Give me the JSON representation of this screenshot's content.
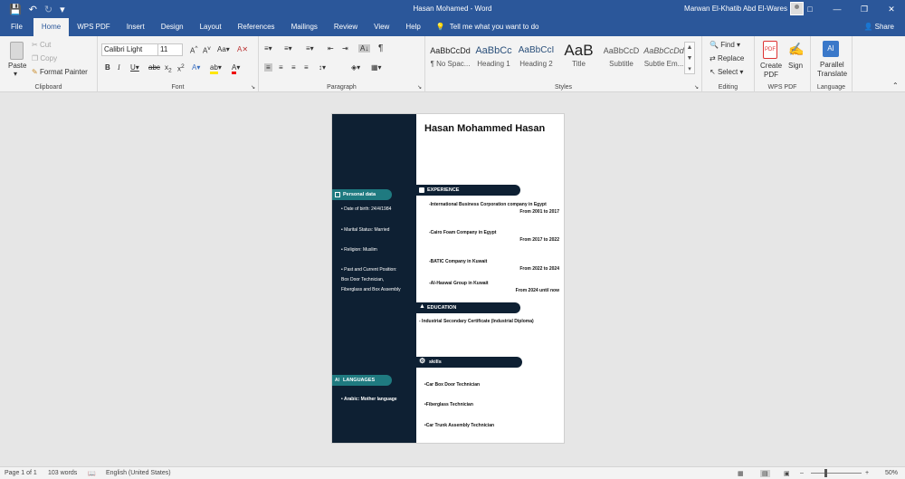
{
  "window": {
    "doc_title": "Hasan Mohamed  -  Word",
    "user_name": "Marwan El-Khatib Abd El-Wares"
  },
  "tabs": [
    "File",
    "Home",
    "WPS PDF",
    "Insert",
    "Design",
    "Layout",
    "References",
    "Mailings",
    "Review",
    "View",
    "Help"
  ],
  "tell_me": "Tell me what you want to do",
  "share": "Share",
  "ribbon": {
    "clipboard": {
      "paste": "Paste",
      "cut": "Cut",
      "copy": "Copy",
      "format_painter": "Format Painter",
      "label": "Clipboard"
    },
    "font": {
      "name": "Calibri Light",
      "size": "11",
      "label": "Font"
    },
    "paragraph": {
      "label": "Paragraph"
    },
    "styles": {
      "label": "Styles",
      "items": [
        {
          "sample": "AaBbCcDd",
          "name": "¶ No Spac..."
        },
        {
          "sample": "AaBbCc",
          "name": "Heading 1"
        },
        {
          "sample": "AaBbCcI",
          "name": "Heading 2"
        },
        {
          "sample": "AaB",
          "name": "Title"
        },
        {
          "sample": "AaBbCcD",
          "name": "Subtitle"
        },
        {
          "sample": "AaBbCcDd",
          "name": "Subtle Em..."
        }
      ]
    },
    "editing": {
      "find": "Find",
      "replace": "Replace",
      "select": "Select",
      "label": "Editing"
    },
    "wps": {
      "create": "Create",
      "pdf": "PDF",
      "sign": "Sign",
      "label": "WPS PDF"
    },
    "language": {
      "parallel": "Parallel",
      "translate": "Translate",
      "label": "Language"
    }
  },
  "document": {
    "name": "Hasan Mohammed Hasan",
    "personal_header": "Personal data",
    "personal": [
      "• Date of birth: 24/4/1984",
      "• Marital Status: Married",
      "• Religion: Muslim",
      "• Past and Current Position:",
      "Box Door Technician,",
      "Fiberglass and Box Assembly"
    ],
    "languages_header": "LANGUAGES",
    "languages": [
      "•   Arabic: Mother language"
    ],
    "experience_header": "EXPERIENCE",
    "experience": [
      {
        "company": "-International Business Corporation company in Egypt",
        "period": "From 2001 to 2017"
      },
      {
        "company": "-Cairo Foam Company in Egypt",
        "period": "From 2017 to 2022"
      },
      {
        "company": "-BATIC Company in Kuwait",
        "period": "From 2022 to 2024"
      },
      {
        "company": "-Al-Haswai Group in Kuwait",
        "period": "From 2024 until now"
      }
    ],
    "education_header": "EDUCATION",
    "education": "- Industrial Secondary Certificate (Industrial Diploma)",
    "skills_header": "skills",
    "skills": [
      "•Car Box Door Technician",
      "•Fiberglass Technician",
      "•Car Trunk Assembly Technician"
    ]
  },
  "status": {
    "page": "Page 1 of 1",
    "words": "103 words",
    "language": "English (United States)",
    "zoom": "50%"
  },
  "colors": {
    "word_blue": "#2b579a",
    "sidebar": "#0e2033",
    "teal": "#1f7a80"
  }
}
